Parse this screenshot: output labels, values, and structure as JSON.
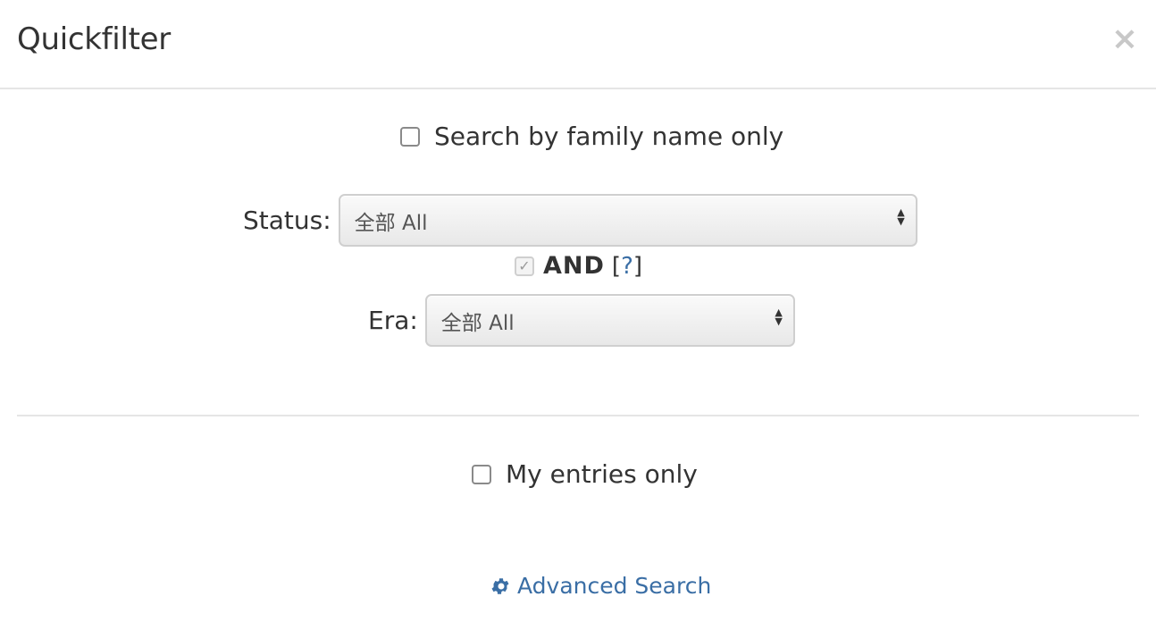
{
  "header": {
    "title": "Quickfilter",
    "close_label": "×"
  },
  "family_name_option": {
    "label": "Search by family name only",
    "checked": false
  },
  "status_filter": {
    "label": "Status:",
    "selected": "全部 All"
  },
  "and_option": {
    "label": "AND",
    "help_open": "[",
    "help_link": "?",
    "help_close": "]",
    "checked": true,
    "disabled": true
  },
  "era_filter": {
    "label": "Era:",
    "selected": "全部 All"
  },
  "my_entries_option": {
    "label": "My entries only",
    "checked": false
  },
  "advanced_search": {
    "label": "Advanced Search",
    "icon": "gear-icon"
  },
  "colors": {
    "link": "#3a6ea5",
    "text": "#333333",
    "divider": "#e5e5e5"
  }
}
